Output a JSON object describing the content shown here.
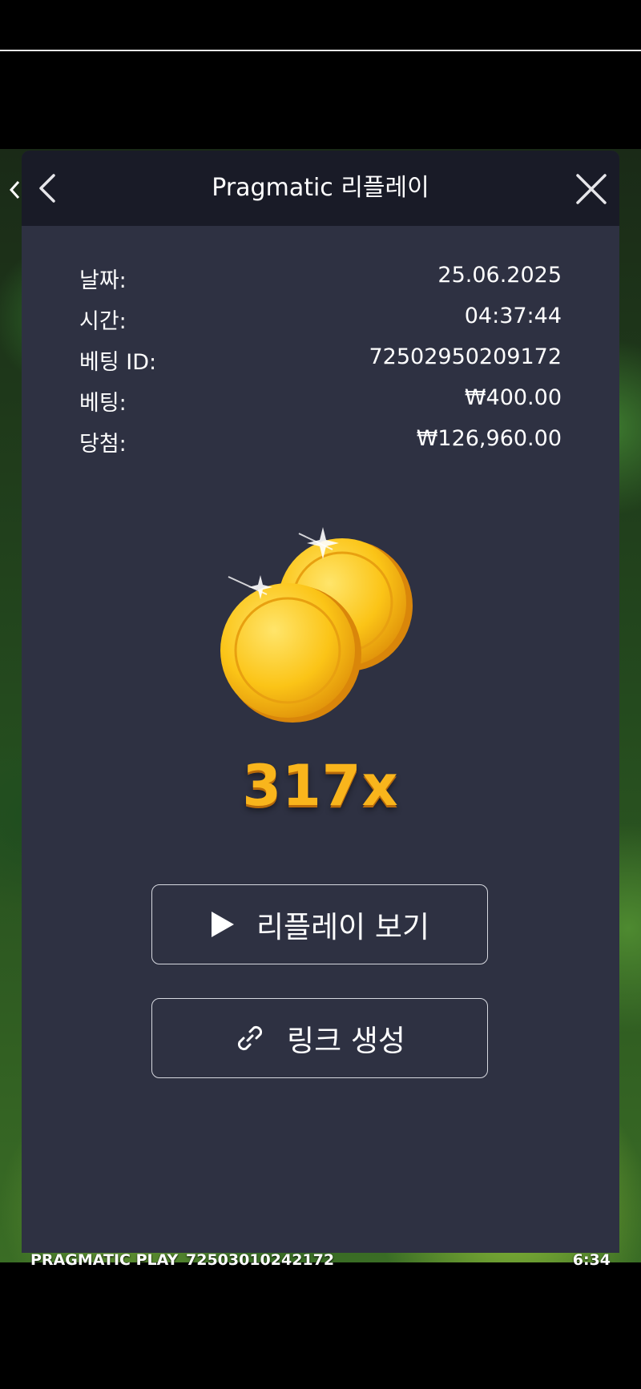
{
  "modal": {
    "title": "Pragmatic 리플레이",
    "info": [
      {
        "label": "날짜:",
        "value": "25.06.2025"
      },
      {
        "label": "시간:",
        "value": "04:37:44"
      },
      {
        "label": "베팅 ID:",
        "value": "72502950209172"
      },
      {
        "label": "베팅:",
        "value": "₩400.00"
      },
      {
        "label": "당첨:",
        "value": "₩126,960.00"
      }
    ],
    "multiplier": "317x",
    "buttons": {
      "replay_label": "리플레이 보기",
      "link_label": "링크 생성"
    }
  },
  "game_footer": {
    "brand": "PRAGMATIC PLAY",
    "round_id": "72503010242172",
    "clock": "6:34"
  },
  "colors": {
    "modal_bg": "#2e3142",
    "header_bg": "#191b27",
    "multiplier": "#f9b51c"
  },
  "icons": [
    "chevron-left-icon",
    "close-icon",
    "coins-icon",
    "play-icon",
    "link-icon"
  ]
}
